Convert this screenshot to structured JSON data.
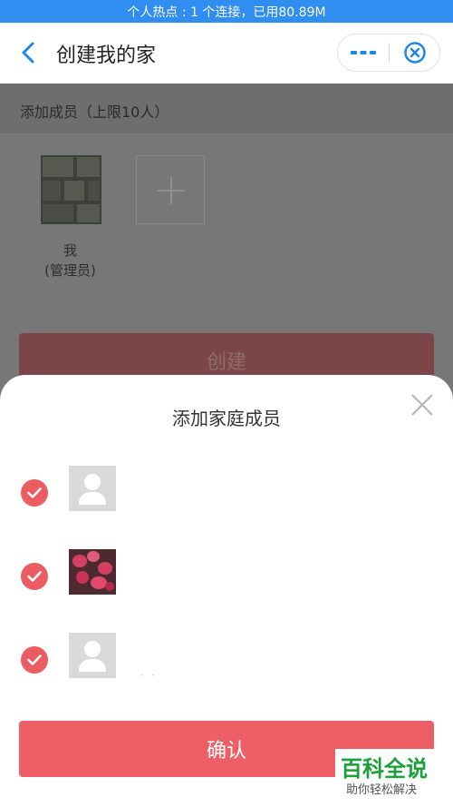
{
  "status_bar": {
    "text": "个人热点 : 1 个连接，已用80.89M"
  },
  "nav": {
    "title": "创建我的家",
    "back_icon": "chevron-left-icon",
    "more_icon": "more-dots-icon",
    "close_icon": "target-close-icon"
  },
  "section": {
    "title": "添加成员（上限10人）"
  },
  "members": [
    {
      "name": "我",
      "role": "(管理员)"
    }
  ],
  "create_button": {
    "label": "创建"
  },
  "sheet": {
    "title": "添加家庭成员",
    "rows": [
      {
        "checked": true,
        "avatar": "default-person"
      },
      {
        "checked": true,
        "avatar": "flower-photo"
      },
      {
        "checked": true,
        "avatar": "default-person",
        "name_fragment": "· ·"
      }
    ],
    "confirm_label": "确认"
  },
  "watermark": {
    "main": "百科全说",
    "sub": "助你轻松解决"
  },
  "colors": {
    "accent": "#ee5e66",
    "status_bar": "#2f8ef0",
    "brand_blue": "#1e88e5"
  }
}
